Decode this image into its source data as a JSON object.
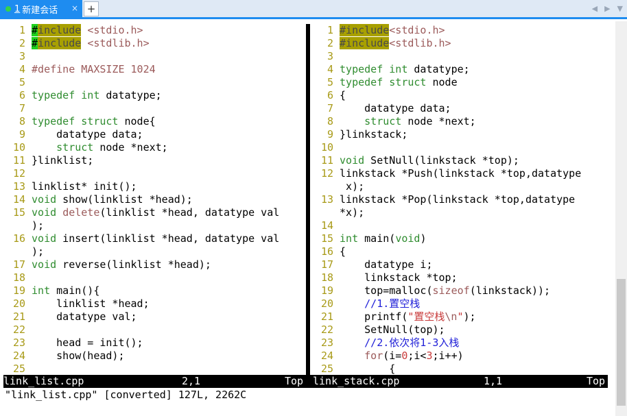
{
  "tabs": [
    {
      "num": "1",
      "label": "新建会话",
      "close": "×"
    }
  ],
  "add_tab": "+",
  "nav": {
    "prev": "◀",
    "next": "▶",
    "menu": "▼"
  },
  "left_pane": {
    "lines": [
      {
        "n": "1",
        "html": "<span class=\"cur\">#</span><span class=\"hl\">include</span> <span class=\"pp\">&lt;stdio.h&gt;</span>"
      },
      {
        "n": "2",
        "html": "<span class=\"cur\">#</span><span class=\"hl\">include</span> <span class=\"pp\">&lt;stdlib.h&gt;</span>"
      },
      {
        "n": "3",
        "html": ""
      },
      {
        "n": "4",
        "html": "<span class=\"pp\">#define MAXSIZE 1024</span>"
      },
      {
        "n": "5",
        "html": ""
      },
      {
        "n": "6",
        "html": "<span class=\"ty\">typedef</span> <span class=\"ty\">int</span> datatype;"
      },
      {
        "n": "7",
        "html": ""
      },
      {
        "n": "8",
        "html": "<span class=\"ty\">typedef</span> <span class=\"ty\">struct</span> node{"
      },
      {
        "n": "9",
        "html": "    datatype data;"
      },
      {
        "n": "10",
        "html": "    <span class=\"ty\">struct</span> node *next;"
      },
      {
        "n": "11",
        "html": "}linklist;"
      },
      {
        "n": "12",
        "html": ""
      },
      {
        "n": "13",
        "html": "linklist* init();"
      },
      {
        "n": "14",
        "html": "<span class=\"ty\">void</span> show(linklist *head);"
      },
      {
        "n": "15",
        "html": "<span class=\"ty\">void</span> <span class=\"pp\">delete</span>(linklist *head, datatype val"
      },
      {
        "n": "",
        "html": ");"
      },
      {
        "n": "16",
        "html": "<span class=\"ty\">void</span> insert(linklist *head, datatype val"
      },
      {
        "n": "",
        "html": ");"
      },
      {
        "n": "17",
        "html": "<span class=\"ty\">void</span> reverse(linklist *head);"
      },
      {
        "n": "18",
        "html": ""
      },
      {
        "n": "19",
        "html": "<span class=\"ty\">int</span> main(){"
      },
      {
        "n": "20",
        "html": "    linklist *head;"
      },
      {
        "n": "21",
        "html": "    datatype val;"
      },
      {
        "n": "22",
        "html": ""
      },
      {
        "n": "23",
        "html": "    head = init();"
      },
      {
        "n": "24",
        "html": "    show(head);"
      },
      {
        "n": "25",
        "html": ""
      }
    ],
    "status_file": "link_list.cpp",
    "status_pos": "2,1",
    "status_scroll": "Top"
  },
  "right_pane": {
    "lines": [
      {
        "n": "1",
        "html": "<span class=\"hl\">#include</span><span class=\"pp\">&lt;stdio.h&gt;</span>"
      },
      {
        "n": "2",
        "html": "<span class=\"hl\">#include</span><span class=\"pp\">&lt;stdlib.h&gt;</span>"
      },
      {
        "n": "3",
        "html": ""
      },
      {
        "n": "4",
        "html": "<span class=\"ty\">typedef</span> <span class=\"ty\">int</span> datatype;"
      },
      {
        "n": "5",
        "html": "<span class=\"ty\">typedef</span> <span class=\"ty\">struct</span> node"
      },
      {
        "n": "6",
        "html": "{"
      },
      {
        "n": "7",
        "html": "    datatype data;"
      },
      {
        "n": "8",
        "html": "    <span class=\"ty\">struct</span> node *next;"
      },
      {
        "n": "9",
        "html": "}linkstack;"
      },
      {
        "n": "10",
        "html": ""
      },
      {
        "n": "11",
        "html": "<span class=\"ty\">void</span> SetNull(linkstack *top);"
      },
      {
        "n": "12",
        "html": "linkstack *Push(linkstack *top,datatype"
      },
      {
        "n": "",
        "html": " x);"
      },
      {
        "n": "13",
        "html": "linkstack *Pop(linkstack *top,datatype"
      },
      {
        "n": "",
        "html": "*x);"
      },
      {
        "n": "14",
        "html": ""
      },
      {
        "n": "15",
        "html": "<span class=\"ty\">int</span> main(<span class=\"ty\">void</span>)"
      },
      {
        "n": "16",
        "html": "{"
      },
      {
        "n": "17",
        "html": "    datatype i;"
      },
      {
        "n": "18",
        "html": "    linkstack *top;"
      },
      {
        "n": "19",
        "html": "    top=malloc(<span class=\"pp\">sizeof</span>(linkstack));"
      },
      {
        "n": "20",
        "html": "    <span class=\"cm\">//1.置空栈</span>"
      },
      {
        "n": "21",
        "html": "    printf(<span class=\"str\">\"置空栈</span><span class=\"pp\">\\n</span><span class=\"str\">\"</span>);"
      },
      {
        "n": "22",
        "html": "    SetNull(top);"
      },
      {
        "n": "23",
        "html": "    <span class=\"cm\">//2.依次将1-3入栈</span>"
      },
      {
        "n": "24",
        "html": "    <span class=\"pp\">for</span>(i=<span class=\"str\">0</span>;i&lt;<span class=\"str\">3</span>;i++)"
      },
      {
        "n": "25",
        "html": "        {"
      }
    ],
    "status_file": "link_stack.cpp",
    "status_pos": "1,1",
    "status_scroll": "Top"
  },
  "cmdline": "\"link_list.cpp\" [converted] 127L, 2262C",
  "colors": {
    "accent": "#1e8cf0",
    "linenr": "#a89a17",
    "type": "#2f8c2f",
    "preproc": "#9b5a5a",
    "comment": "#2020d8"
  }
}
